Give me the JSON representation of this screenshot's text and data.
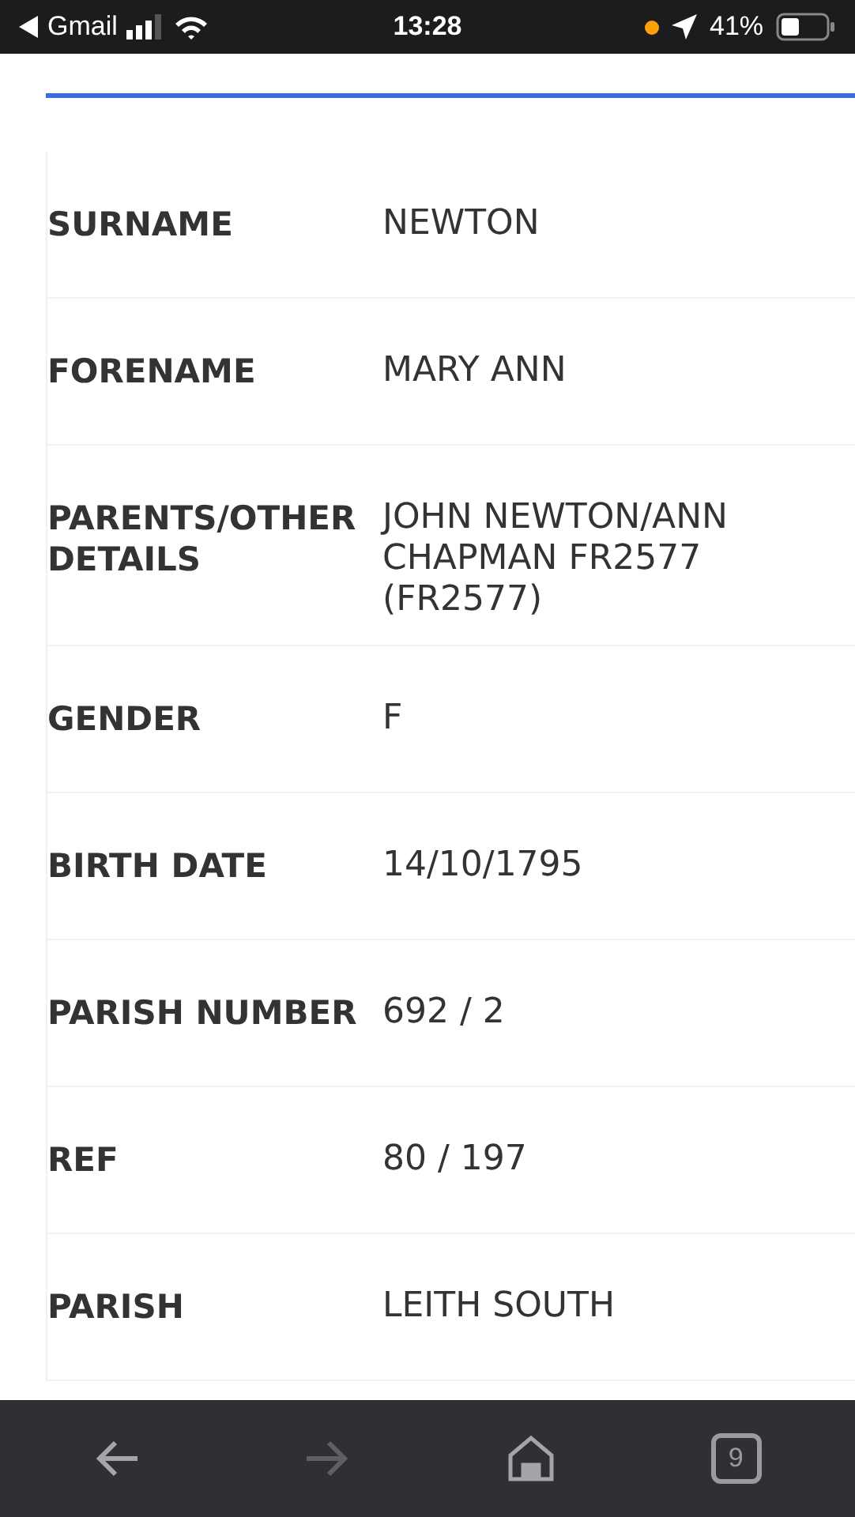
{
  "status_bar": {
    "back_app": "Gmail",
    "time": "13:28",
    "battery": "41%"
  },
  "record": [
    {
      "label": "SURNAME",
      "value": "NEWTON"
    },
    {
      "label": "FORENAME",
      "value": "MARY ANN"
    },
    {
      "label": "PARENTS/OTHER DETAILS",
      "value": "JOHN NEWTON/ANN CHAPMAN FR2577 (FR2577)"
    },
    {
      "label": "GENDER",
      "value": "F"
    },
    {
      "label": "BIRTH DATE",
      "value": "14/10/1795"
    },
    {
      "label": "PARISH NUMBER",
      "value": "692 / 2"
    },
    {
      "label": "REF",
      "value": "80 / 197"
    },
    {
      "label": "PARISH",
      "value": "LEITH SOUTH"
    }
  ],
  "toolbar": {
    "back": {
      "disabled": false
    },
    "forward": {
      "disabled": true
    },
    "tab_count": "9"
  }
}
